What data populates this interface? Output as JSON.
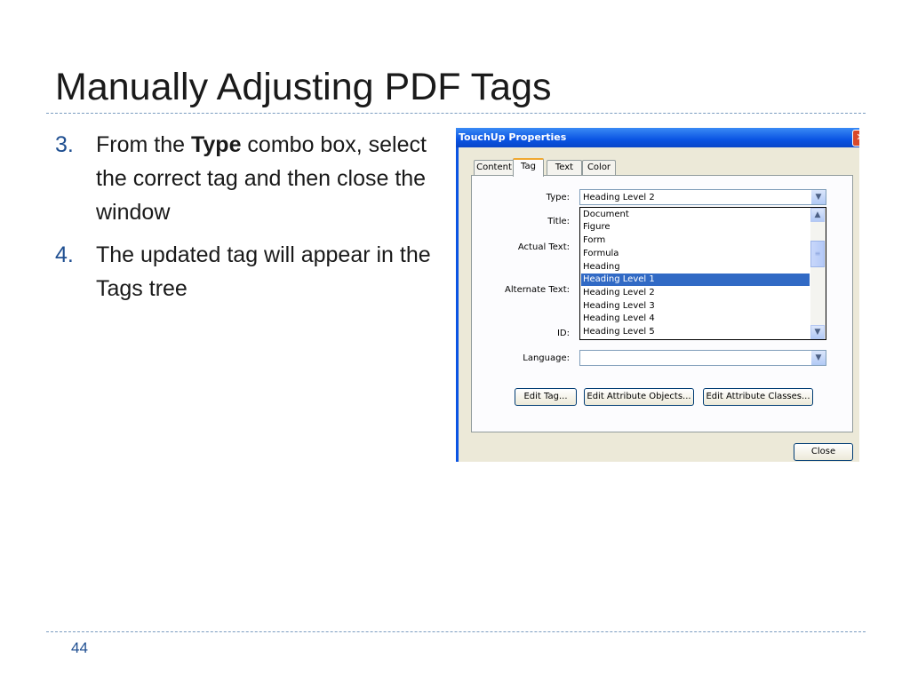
{
  "slide": {
    "title": "Manually Adjusting PDF Tags",
    "page_number": "44",
    "steps": [
      {
        "num": "3.",
        "pre": "From the ",
        "bold": "Type",
        "post": " combo box, select the correct tag and then close the window"
      },
      {
        "num": "4.",
        "text": "The updated tag will appear in the Tags tree"
      }
    ]
  },
  "dialog": {
    "title": "TouchUp Properties",
    "tabs": [
      "Content",
      "Tag",
      "Text",
      "Color"
    ],
    "active_tab": "Tag",
    "labels": {
      "type": "Type:",
      "title": "Title:",
      "actual_text": "Actual Text:",
      "alternate_text": "Alternate Text:",
      "id": "ID:",
      "language": "Language:"
    },
    "type_value": "Heading Level 2",
    "language_value": "",
    "type_options": [
      "Document",
      "Figure",
      "Form",
      "Formula",
      "Heading",
      "Heading Level 1",
      "Heading Level 2",
      "Heading Level 3",
      "Heading Level 4",
      "Heading Level 5"
    ],
    "highlighted_option": "Heading Level 1",
    "buttons": {
      "edit_tag": "Edit Tag...",
      "edit_attribute_objects": "Edit Attribute Objects...",
      "edit_attribute_classes": "Edit Attribute Classes...",
      "close": "Close"
    }
  },
  "colors": {
    "accent": "#1f4f91",
    "titlebar": "#0a54e3",
    "selection": "#316ac5"
  }
}
